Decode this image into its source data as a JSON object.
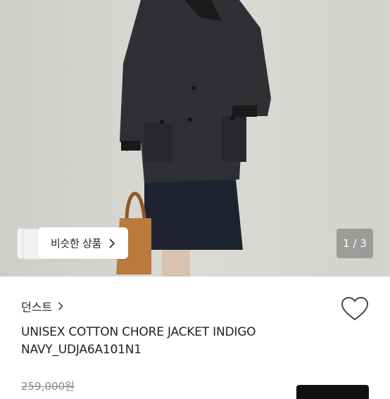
{
  "product": {
    "image_counter": "1 / 3",
    "similar_label": "비슷한 상품",
    "brand": "던스트",
    "title": "UNISEX COTTON CHORE JACKET INDIGO NAVY_UDJA6A101N1",
    "original_price": "259,000원"
  },
  "icons": {
    "similar_chevron": "chevron-right-icon",
    "brand_chevron": "chevron-right-icon",
    "favorite": "heart-outline-icon"
  },
  "colors": {
    "background_wall": "#d6d4cf",
    "jacket": "#2d2f33",
    "skirt": "#1f2330",
    "text": "#222222",
    "price_strike": "#888888"
  }
}
